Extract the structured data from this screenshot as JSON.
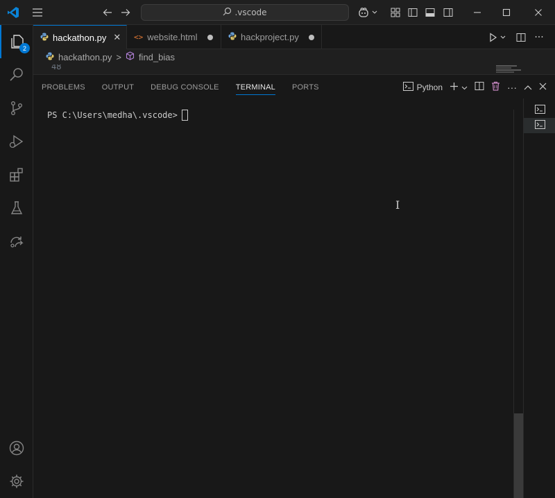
{
  "titlebar": {
    "search_text": ".vscode",
    "icons": [
      "vscode-logo-icon",
      "menu-icon",
      "back-arrow-icon",
      "forward-arrow-icon",
      "search-icon",
      "copilot-icon",
      "layout-customize-icon",
      "toggle-sidebar-icon",
      "toggle-panel-icon",
      "toggle-secondary-sidebar-icon",
      "minimize-icon",
      "maximize-icon",
      "close-icon"
    ]
  },
  "activitybar": {
    "explorer_badge": "2",
    "items": [
      "explorer-icon",
      "search-icon",
      "source-control-icon",
      "run-debug-icon",
      "extensions-icon",
      "testing-icon",
      "remote-explorer-icon",
      "accounts-icon",
      "manage-gear-icon"
    ]
  },
  "tabs": [
    {
      "label": "hackathon.py",
      "icon": "python-icon",
      "active": true
    },
    {
      "label": "website.html",
      "icon": "html-icon",
      "active": false
    },
    {
      "label": "hackproject.py",
      "icon": "python-icon",
      "active": false
    }
  ],
  "breadcrumb": {
    "file": "hackathon.py",
    "separator": ">",
    "symbol": "find_bias"
  },
  "editor": {
    "visible_line_number": "48"
  },
  "panel": {
    "tabs": [
      "PROBLEMS",
      "OUTPUT",
      "DEBUG CONSOLE",
      "TERMINAL",
      "PORTS"
    ],
    "active_tab": "TERMINAL",
    "terminal_profile": "Python",
    "terminal_prompt": "PS C:\\Users\\medha\\.vscode>"
  },
  "colors": {
    "accent": "#0078d4",
    "background": "#181818",
    "text": "#cccccc"
  }
}
